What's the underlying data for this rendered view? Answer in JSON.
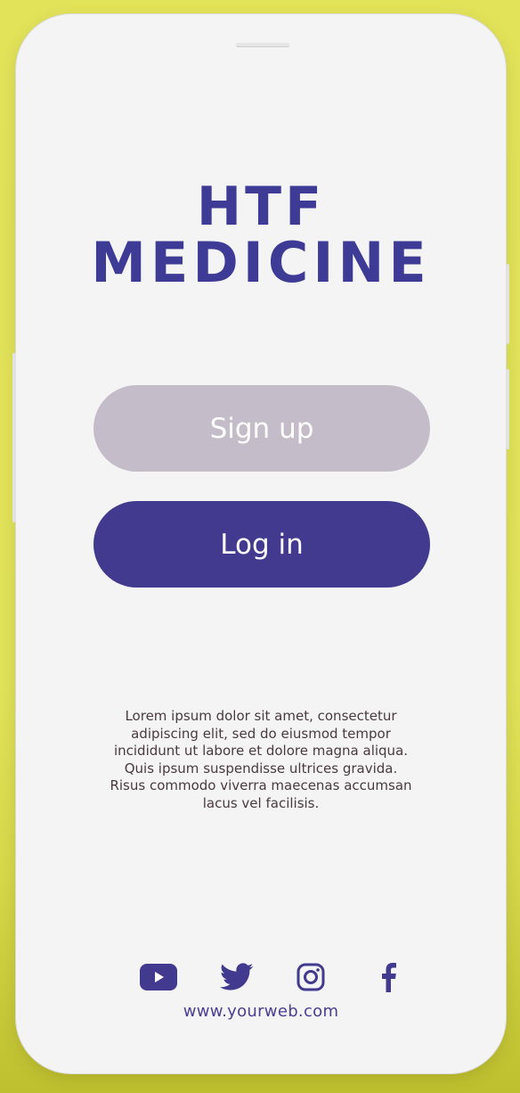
{
  "app": {
    "title_line1": "HTF",
    "title_line2": "MEDICINE"
  },
  "actions": {
    "signup_label": "Sign up",
    "login_label": "Log in"
  },
  "description": "Lorem ipsum dolor sit amet, consectetur adipiscing elit, sed do eiusmod tempor incididunt ut labore et dolore magna aliqua. Quis ipsum suspendisse ultrices gravida. Risus commodo viverra maecenas accumsan lacus vel facilisis.",
  "social": {
    "icons": [
      "youtube-icon",
      "twitter-icon",
      "instagram-icon",
      "facebook-icon"
    ]
  },
  "footer": {
    "website": "www.yourweb.com"
  },
  "colors": {
    "background": "#e3e35a",
    "screen": "#f4f4f4",
    "primary": "#423a8f",
    "secondary": "#c5bcc9",
    "title": "#3d3b95",
    "text": "#4a3a3f"
  }
}
